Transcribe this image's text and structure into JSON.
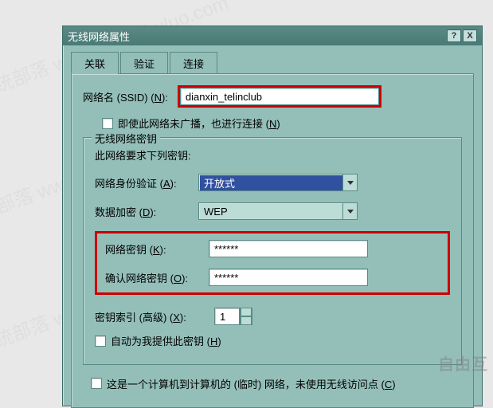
{
  "window": {
    "title": "无线网络属性",
    "help_btn": "?",
    "close_btn": "X"
  },
  "tabs": {
    "t0": "关联",
    "t1": "验证",
    "t2": "连接"
  },
  "ssid": {
    "label_pre": "网络名 (SSID) (",
    "label_accel": "N",
    "label_post": "):",
    "value": "dianxin_telinclub"
  },
  "broadcast": {
    "label_pre": "即使此网络未广播，也进行连接 (",
    "label_accel": "N",
    "label_post": ")"
  },
  "keygroup": {
    "legend": "无线网络密钥",
    "require": "此网络要求下列密钥:",
    "auth_label_pre": "网络身份验证 (",
    "auth_label_accel": "A",
    "auth_label_post": "):",
    "auth_value": "开放式",
    "enc_label_pre": "数据加密 (",
    "enc_label_accel": "D",
    "enc_label_post": "):",
    "enc_value": "WEP",
    "key_label_pre": "网络密钥 (",
    "key_label_accel": "K",
    "key_label_post": "):",
    "key_value": "******",
    "confirm_label_pre": "确认网络密钥 (",
    "confirm_label_accel": "O",
    "confirm_label_post": "):",
    "confirm_value": "******",
    "index_label_pre": "密钥索引 (高级) (",
    "index_label_accel": "X",
    "index_label_post": "):",
    "index_value": "1",
    "auto_label_pre": "自动为我提供此密钥 (",
    "auto_label_accel": "H",
    "auto_label_post": ")"
  },
  "footer": {
    "adhoc_label_pre": "这是一个计算机到计算机的 (临时) 网络，未使用无线访问点 (",
    "adhoc_label_accel": "C",
    "adhoc_label_post": ")"
  },
  "watermark": "自由互"
}
